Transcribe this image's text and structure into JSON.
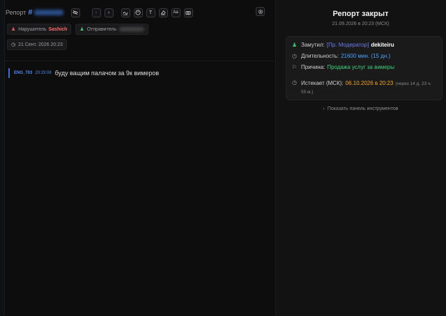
{
  "header": {
    "report_label": "Репорт",
    "hash": "#",
    "id_hidden": "",
    "tools": [
      {
        "name": "eye-off-icon"
      },
      {
        "name": "chevron-left-icon",
        "glyph": "‹"
      },
      {
        "name": "chevron-right-icon",
        "glyph": "›"
      },
      {
        "name": "signature-icon"
      },
      {
        "name": "palette-icon"
      },
      {
        "name": "text-icon",
        "glyph": "T"
      },
      {
        "name": "eraser-icon"
      },
      {
        "name": "font-size-icon",
        "glyph": "Aa"
      },
      {
        "name": "camera-icon"
      }
    ],
    "settings_icon": "gear-icon"
  },
  "chips": {
    "violator_label": "Нарушитель",
    "violator_name": "Sashich",
    "sender_label": "Отправитель",
    "date": "21 Сент. 2026 20:23"
  },
  "message": {
    "author": "ENG_703",
    "time": "20:23:08",
    "text": "буду ващим палачом за 9к вимеров"
  },
  "status": {
    "title": "Репорт закрыт",
    "date": "21.09.2026 в 20:23 (МСК)"
  },
  "punishment": {
    "muted_label": "Замутил:",
    "moderator_role": "[Пр. Модератор]",
    "moderator_name": "dekiteiru",
    "duration_label": "Длительность:",
    "duration_value": "21600 мин. (15 дн.)",
    "reason_label": "Причина:",
    "reason_value": "Продажа услуг за вимеры",
    "expires_label": "Истекает (МСК):",
    "expires_value": "06.10.2026 в 20:23",
    "expires_note": "(через 14 д. 23 ч. 55 м.)"
  },
  "tools_panel": {
    "label": "Показать панель инструментов"
  },
  "colors": {
    "accent_blue": "#4f8df7",
    "violator_red": "#ff6b6b",
    "success_green": "#3fd07c",
    "warning_orange": "#f5a623",
    "moderator_purple": "#6a7cf0"
  }
}
